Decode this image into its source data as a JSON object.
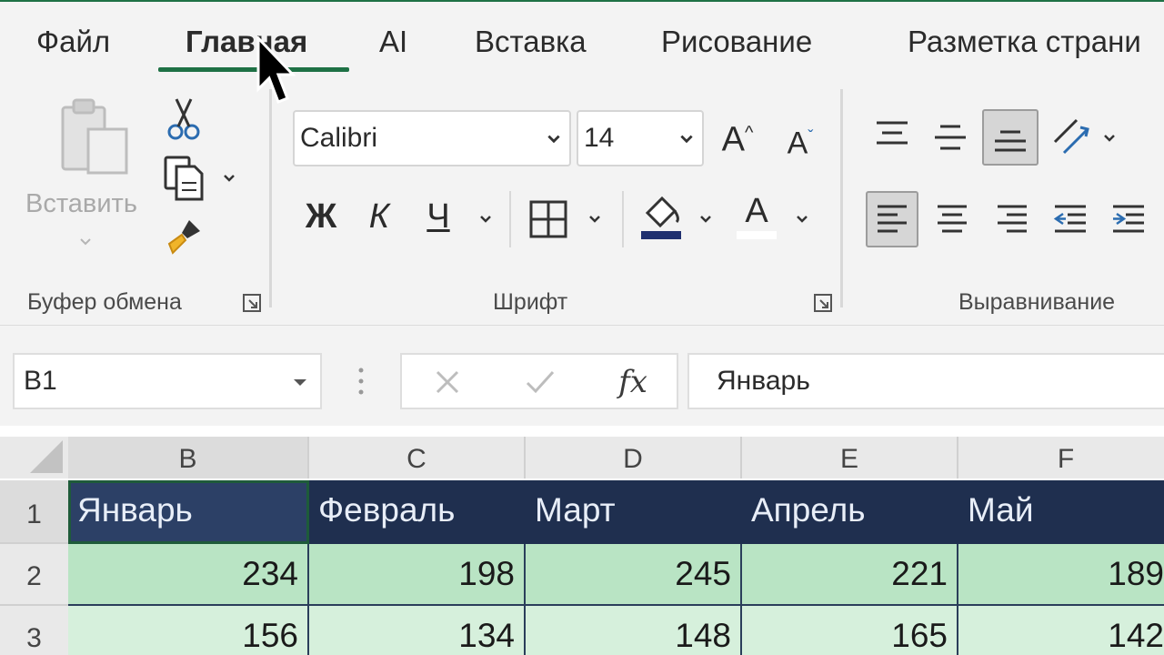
{
  "ribbon_tabs": [
    {
      "label": "Файл"
    },
    {
      "label": "Главная"
    },
    {
      "label": "AI"
    },
    {
      "label": "Вставка"
    },
    {
      "label": "Рисование"
    },
    {
      "label": "Разметка страни"
    }
  ],
  "clipboard": {
    "paste_label": "Вставить",
    "group_label": "Буфер обмена"
  },
  "font": {
    "font_name": "Calibri",
    "font_size": "14",
    "increase_label": "A",
    "decrease_label": "A",
    "bold_label": "Ж",
    "italic_label": "К",
    "underline_label": "Ч",
    "font_color_label": "A",
    "group_label": "Шрифт"
  },
  "alignment": {
    "group_label": "Выравнивание"
  },
  "formula_bar": {
    "name_box": "B1",
    "fx_label": "fx",
    "value": "Январь"
  },
  "grid": {
    "columns": [
      "B",
      "C",
      "D",
      "E",
      "F"
    ],
    "rows": [
      "1",
      "2",
      "3"
    ],
    "header_row": [
      "Январь",
      "Февраль",
      "Март",
      "Апрель",
      "Май"
    ],
    "row2": [
      "234",
      "198",
      "245",
      "221",
      "189"
    ],
    "row3": [
      "156",
      "134",
      "148",
      "165",
      "142"
    ]
  },
  "colors": {
    "accent": "#1e7145",
    "header_fill": "#1f2f4f",
    "row2_fill": "#b9e4c4",
    "row3_fill": "#d6f0dc"
  }
}
